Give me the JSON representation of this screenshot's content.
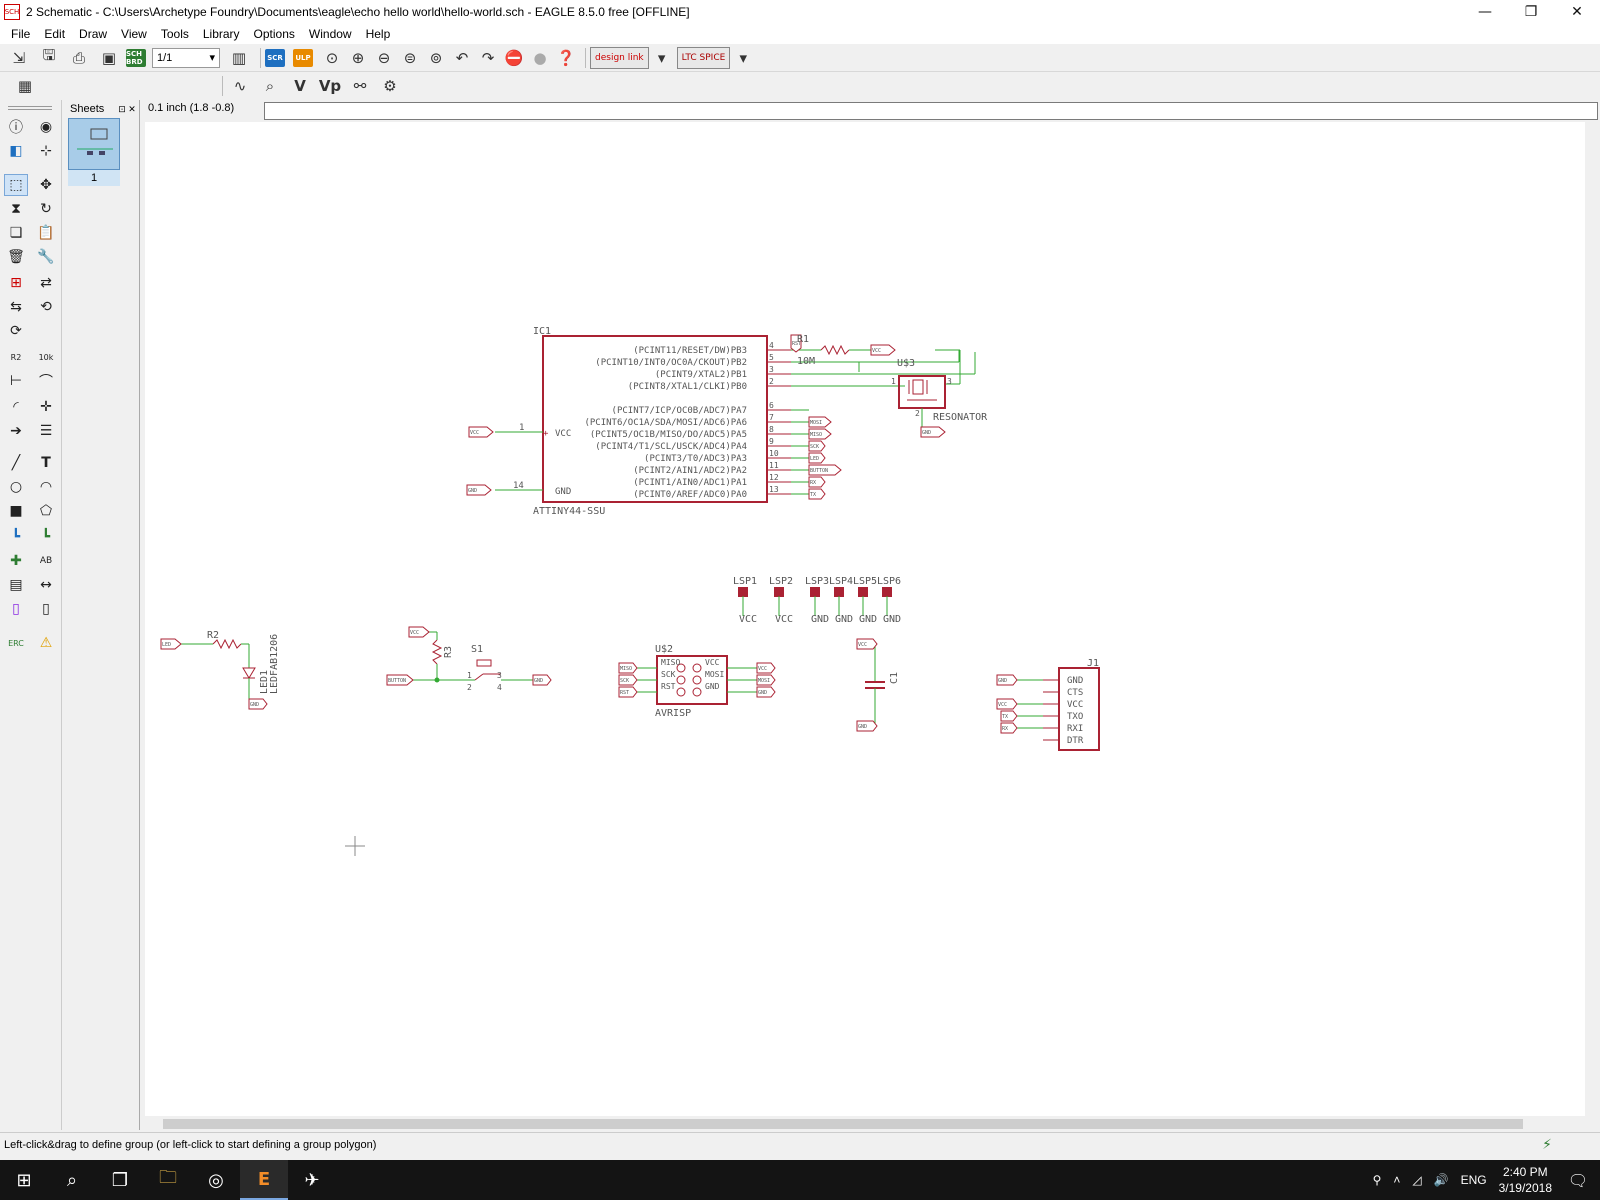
{
  "window": {
    "title": "2 Schematic - C:\\Users\\Archetype Foundry\\Documents\\eagle\\echo hello world\\hello-world.sch - EAGLE 8.5.0 free [OFFLINE]",
    "app_icon": "SCH"
  },
  "menu": [
    "File",
    "Edit",
    "Draw",
    "View",
    "Tools",
    "Library",
    "Options",
    "Window",
    "Help"
  ],
  "toolbar": {
    "sheet_select": "1/1",
    "design_link": "design link",
    "ltspice": "LTC SPICE",
    "scr": "SCR",
    "ulp": "ULP",
    "sch_brd": "SCH BRD"
  },
  "sheets": {
    "header": "Sheets",
    "number": "1"
  },
  "coord_readout": "0.1 inch (1.8 -0.8)",
  "status": "Left-click&drag to define group (or left-click to start defining a group polygon)",
  "tools": {
    "erc": "ERC",
    "text_tool": "T"
  },
  "taskbar": {
    "lang": "ENG",
    "time": "2:40 PM",
    "date": "3/19/2018"
  },
  "schematic": {
    "ic1": {
      "name": "IC1",
      "value": "ATTINY44-SSU",
      "vcc_label": "VCC",
      "gnd_label": "GND",
      "vcc_pin": "1",
      "gnd_pin": "14",
      "pins_top": [
        {
          "label": "(PCINT11/RESET/DW)PB3",
          "num": "4"
        },
        {
          "label": "(PCINT10/INT0/OC0A/CKOUT)PB2",
          "num": "5"
        },
        {
          "label": "(PCINT9/XTAL2)PB1",
          "num": "3"
        },
        {
          "label": "(PCINT8/XTAL1/CLKI)PB0",
          "num": "2"
        }
      ],
      "pins_bottom": [
        {
          "label": "(PCINT7/ICP/OC0B/ADC7)PA7",
          "num": "6"
        },
        {
          "label": "(PCINT6/OC1A/SDA/MOSI/ADC6)PA6",
          "num": "7"
        },
        {
          "label": "(PCINT5/OC1B/MISO/DO/ADC5)PA5",
          "num": "8"
        },
        {
          "label": "(PCINT4/T1/SCL/USCK/ADC4)PA4",
          "num": "9"
        },
        {
          "label": "(PCINT3/T0/ADC3)PA3",
          "num": "10"
        },
        {
          "label": "(PCINT2/AIN1/ADC2)PA2",
          "num": "11"
        },
        {
          "label": "(PCINT1/AIN0/ADC1)PA1",
          "num": "12"
        },
        {
          "label": "(PCINT0/AREF/ADC0)PA0",
          "num": "13"
        }
      ],
      "net_tags": [
        "RST",
        "MOSI",
        "MISO",
        "SCK",
        "LED",
        "BUTTON",
        "RX",
        "TX"
      ]
    },
    "r1": {
      "name": "R1",
      "value": "10M",
      "tag": "VCC"
    },
    "u3": {
      "name": "U$3",
      "value": "RESONATOR",
      "pin1": "1",
      "pin2": "2",
      "pin3": "3",
      "tag": "GND"
    },
    "lsp": [
      {
        "name": "LSP1",
        "net": "VCC"
      },
      {
        "name": "LSP2",
        "net": "VCC"
      },
      {
        "name": "LSP3",
        "net": "GND"
      },
      {
        "name": "LSP4",
        "net": "GND"
      },
      {
        "name": "LSP5",
        "net": "GND"
      },
      {
        "name": "LSP6",
        "net": "GND"
      }
    ],
    "r2": {
      "name": "R2",
      "tag_in": "LED",
      "tag_gnd": "GND"
    },
    "led1": {
      "name": "LED1",
      "value": "LEDFAB1206"
    },
    "r3": {
      "name": "R3",
      "tag_vcc": "VCC",
      "tag_button": "BUTTON"
    },
    "s1": {
      "name": "S1",
      "tag_gnd": "GND",
      "pins": [
        "1",
        "2",
        "3",
        "4"
      ]
    },
    "u2": {
      "name": "U$2",
      "value": "AVRISP",
      "left": [
        "MISO",
        "SCK",
        "RST"
      ],
      "right": [
        "VCC",
        "MOSI",
        "GND"
      ],
      "tags_left": [
        "MISO",
        "SCK",
        "RST"
      ],
      "tags_right": [
        "VCC",
        "MOSI",
        "GND"
      ]
    },
    "c1": {
      "name": "C1",
      "tag_vcc": "VCC",
      "tag_gnd": "GND"
    },
    "j1": {
      "name": "J1",
      "pins": [
        "GND",
        "CTS",
        "VCC",
        "TXO",
        "RXI",
        "DTR"
      ],
      "tags": [
        "GND",
        "VCC",
        "TX",
        "RX"
      ]
    }
  }
}
